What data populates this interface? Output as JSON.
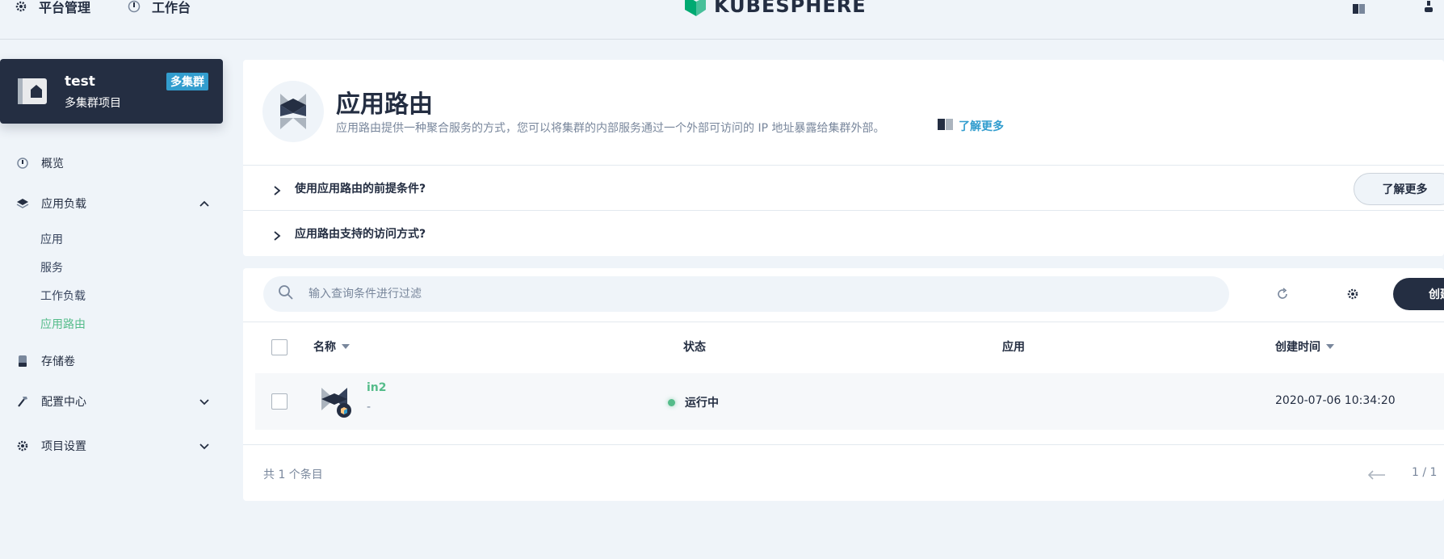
{
  "topbar": {
    "platform_label": "平台管理",
    "workbench_label": "工作台",
    "logo_text": "KUBESPHERE"
  },
  "project": {
    "name": "test",
    "subtitle": "多集群项目",
    "badge": "多集群"
  },
  "sidebar": {
    "items": [
      {
        "label": "概览",
        "icon": "dashboard-icon"
      },
      {
        "label": "应用负载",
        "icon": "layers-icon",
        "expanded": true
      },
      {
        "label": "存储卷",
        "icon": "storage-icon"
      },
      {
        "label": "配置中心",
        "icon": "hammer-icon"
      },
      {
        "label": "项目设置",
        "icon": "gear-icon"
      }
    ],
    "sub_items": [
      {
        "label": "应用"
      },
      {
        "label": "服务"
      },
      {
        "label": "工作负载"
      },
      {
        "label": "应用路由",
        "active": true
      }
    ]
  },
  "banner": {
    "title": "应用路由",
    "description": "应用路由提供一种聚合服务的方式，您可以将集群的内部服务通过一个外部可访问的 IP 地址暴露给集群外部。",
    "learn_more": "了解更多",
    "faq": [
      {
        "question": "使用应用路由的前提条件?"
      },
      {
        "question": "应用路由支持的访问方式?"
      }
    ],
    "faq_button": "了解更多"
  },
  "table": {
    "search_placeholder": "输入查询条件进行过滤",
    "create_label": "创建",
    "columns": [
      "名称",
      "状态",
      "应用",
      "创建时间"
    ],
    "rows": [
      {
        "name": "in2",
        "description": "-",
        "status": "运行中",
        "app": "",
        "created": "2020-07-06 10:34:20"
      }
    ],
    "total_text": "共 1 个条目",
    "page_text": "1 / 1"
  },
  "colors": {
    "sidebar_active": "#55bc8a",
    "dark": "#242e42",
    "badge": "#329dce",
    "status_running": "#55bc8a"
  }
}
